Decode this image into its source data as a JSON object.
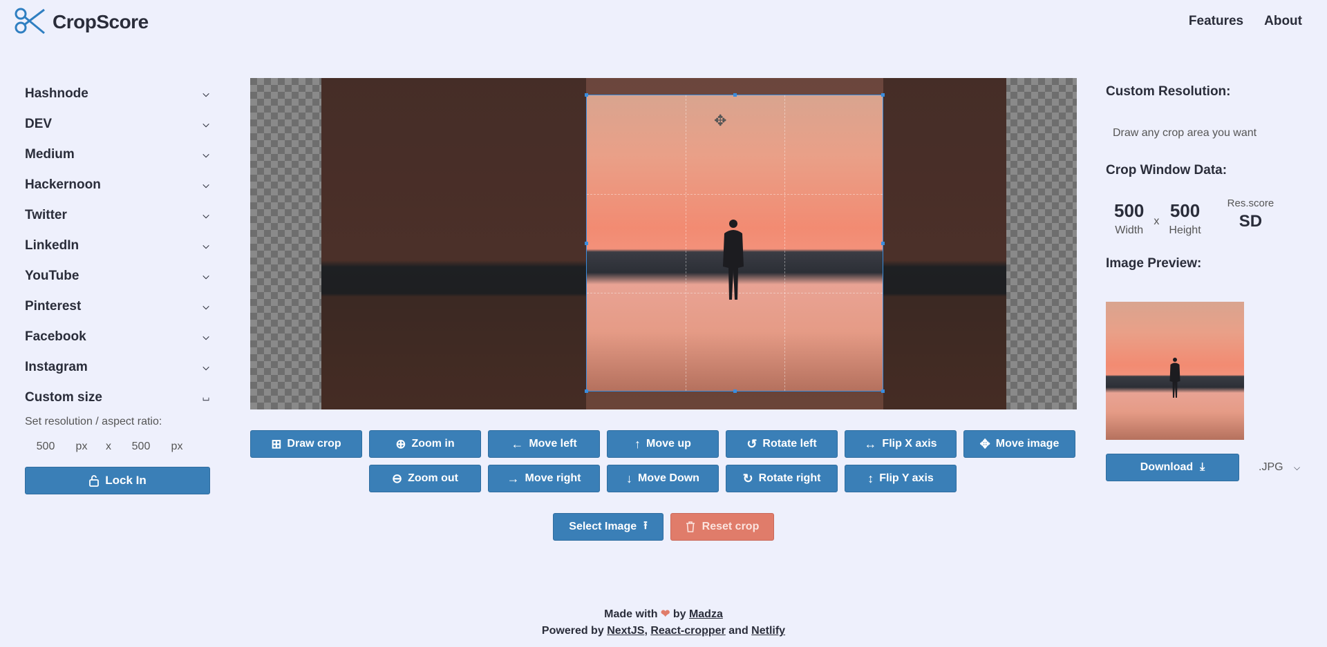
{
  "header": {
    "logo_text": "CropScore",
    "nav": [
      {
        "label": "Features"
      },
      {
        "label": "About"
      }
    ]
  },
  "sidebar": {
    "items": [
      {
        "label": "Hashnode"
      },
      {
        "label": "DEV"
      },
      {
        "label": "Medium"
      },
      {
        "label": "Hackernoon"
      },
      {
        "label": "Twitter"
      },
      {
        "label": "LinkedIn"
      },
      {
        "label": "YouTube"
      },
      {
        "label": "Pinterest"
      },
      {
        "label": "Facebook"
      },
      {
        "label": "Instagram"
      },
      {
        "label": "Custom size"
      }
    ],
    "custom": {
      "label": "Set resolution / aspect ratio:",
      "width_value": "500",
      "height_value": "500",
      "unit": "px",
      "sep": "x",
      "lock_label": "Lock In"
    }
  },
  "controls": {
    "row1": [
      {
        "label": "Draw crop",
        "icon": "crop-icon"
      },
      {
        "label": "Zoom in",
        "icon": "zoom-in-icon"
      },
      {
        "label": "Move left",
        "icon": "arrow-left-icon"
      },
      {
        "label": "Move up",
        "icon": "arrow-up-icon"
      },
      {
        "label": "Rotate left",
        "icon": "rotate-left-icon"
      },
      {
        "label": "Flip X axis",
        "icon": "flip-x-icon"
      },
      {
        "label": "Move image",
        "icon": "move-icon"
      }
    ],
    "row2": [
      {
        "label": "Zoom out",
        "icon": "zoom-out-icon"
      },
      {
        "label": "Move right",
        "icon": "arrow-right-icon"
      },
      {
        "label": "Move Down",
        "icon": "arrow-down-icon"
      },
      {
        "label": "Rotate right",
        "icon": "rotate-right-icon"
      },
      {
        "label": "Flip Y axis",
        "icon": "flip-y-icon"
      }
    ],
    "select_image": "Select Image",
    "reset_crop": "Reset crop"
  },
  "right_panel": {
    "custom_title": "Custom Resolution:",
    "custom_desc": "Draw any crop area you want",
    "data_title": "Crop Window Data:",
    "width": "500",
    "width_label": "Width",
    "height": "500",
    "height_label": "Height",
    "x_sep": "x",
    "score_label": "Res.score",
    "score_value": "SD",
    "preview_title": "Image Preview:",
    "download_label": "Download",
    "format": ".JPG"
  },
  "footer": {
    "made_with": "Made with",
    "by": "by",
    "author": "Madza",
    "powered_by": "Powered by",
    "tech1": "NextJS",
    "tech2": "React-cropper",
    "and": "and",
    "tech3": "Netlify"
  },
  "colors": {
    "accent": "#3a7fb7",
    "danger": "#e07c6a",
    "background": "#eef0fc"
  }
}
